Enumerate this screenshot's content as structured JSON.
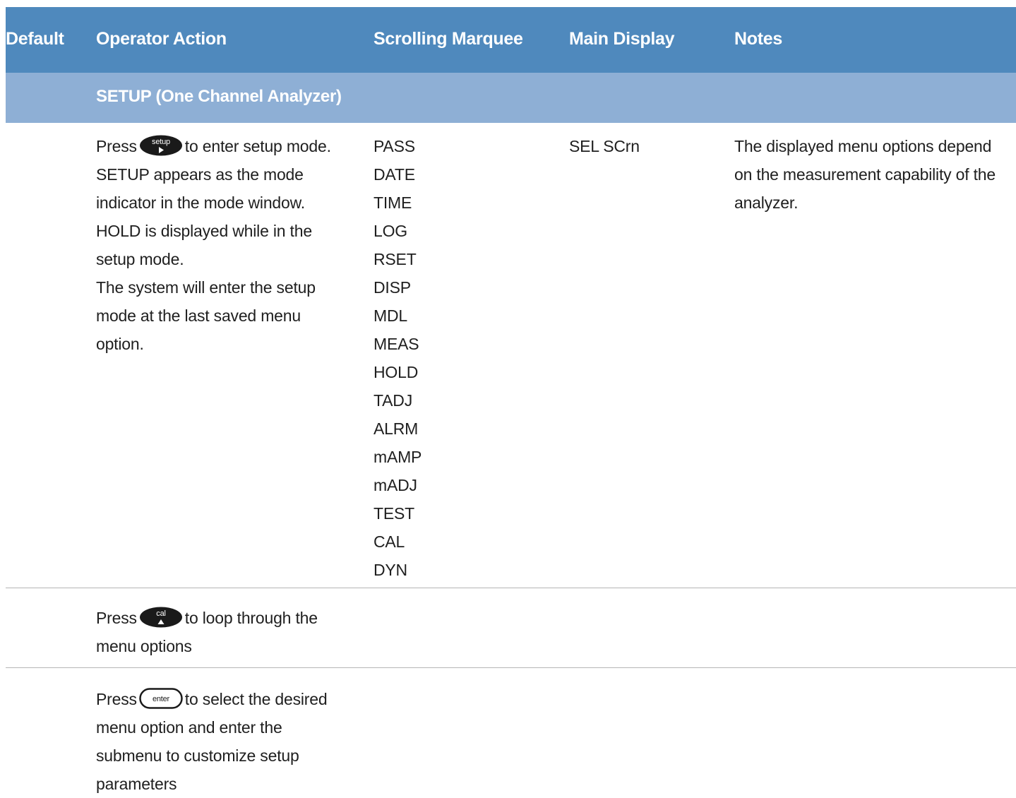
{
  "header": {
    "default": "Default",
    "operator_action": "Operator Action",
    "scrolling_marquee": "Scrolling Marquee",
    "main_display": "Main Display",
    "notes": "Notes"
  },
  "section": {
    "title": "SETUP (One Channel Analyzer)"
  },
  "rows": [
    {
      "action": {
        "pre": "Press",
        "button": "setup",
        "line1": "to enter setup mode.",
        "lines": [
          "SETUP appears as the mode",
          "indicator in the mode window.",
          "HOLD is displayed while in the",
          "setup mode.",
          "The system will enter the setup",
          "mode at the last saved menu",
          "option."
        ]
      },
      "marquee": [
        "PASS",
        "DATE",
        "TIME",
        "LOG",
        "RSET",
        "DISP",
        "MDL",
        "MEAS",
        "HOLD",
        "TADJ",
        "ALRM",
        "mAMP",
        "mADJ",
        "TEST",
        "CAL",
        "DYN"
      ],
      "main_display": "SEL SCrn",
      "notes": [
        "The displayed menu options depend",
        "on the measurement capability of the",
        "analyzer."
      ]
    },
    {
      "action": {
        "pre": "Press",
        "button": "cal",
        "line1": "to loop through the",
        "lines": [
          "menu options"
        ]
      }
    },
    {
      "action": {
        "pre": "Press",
        "button": "enter",
        "line1": "to select the desired",
        "lines": [
          "menu option and enter the",
          "submenu to customize setup",
          "parameters"
        ]
      }
    }
  ],
  "colors": {
    "header_bg": "#4f89bd",
    "section_bg": "#8eafd5",
    "divider": "#b5b5b5"
  },
  "icons": [
    "setup-button-icon",
    "cal-button-icon",
    "enter-button-icon"
  ]
}
